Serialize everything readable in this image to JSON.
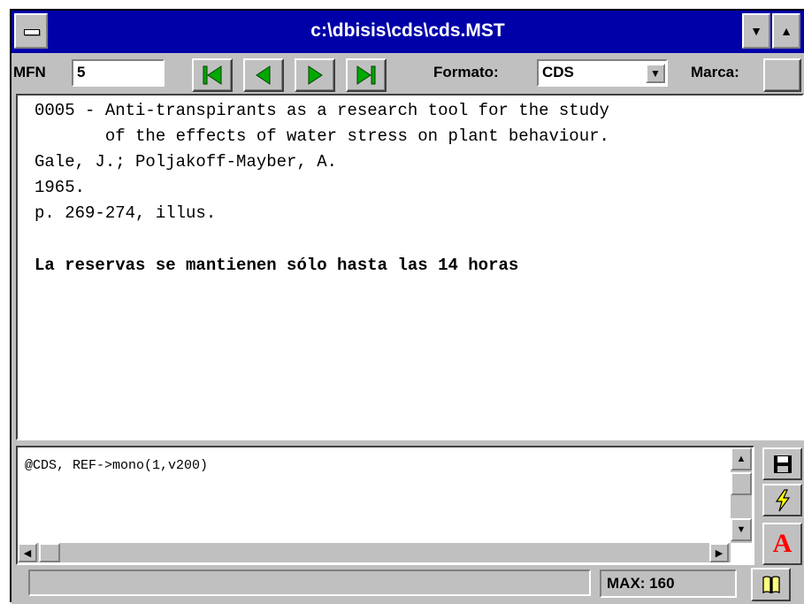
{
  "window": {
    "title": "c:\\dbisis\\cds\\cds.MST",
    "colors": {
      "titlebar": "#0000a8",
      "face": "#c0c0c0",
      "nav_arrow": "#00a800"
    }
  },
  "toolbar": {
    "mfn_label": "MFN",
    "mfn_value": "5",
    "nav_buttons": [
      "first-record-icon",
      "previous-record-icon",
      "next-record-icon",
      "last-record-icon"
    ],
    "format_label": "Formato:",
    "format_value": "CDS",
    "mark_label": "Marca:"
  },
  "record": {
    "lines": [
      "0005 - Anti-transpirants as a research tool for the study",
      "       of the effects of water stress on plant behaviour.",
      "Gale, J.; Poljakoff-Mayber, A.",
      "1965.",
      "p. 269-274, illus."
    ],
    "notice": "La reservas se mantienen sólo hasta las 14 horas"
  },
  "editor": {
    "format_text": "@CDS, REF->mono(1,v200)"
  },
  "side_buttons": [
    "save-icon",
    "lightning-icon",
    "font-icon"
  ],
  "status": {
    "message": "",
    "max_text": "MAX: 160"
  }
}
